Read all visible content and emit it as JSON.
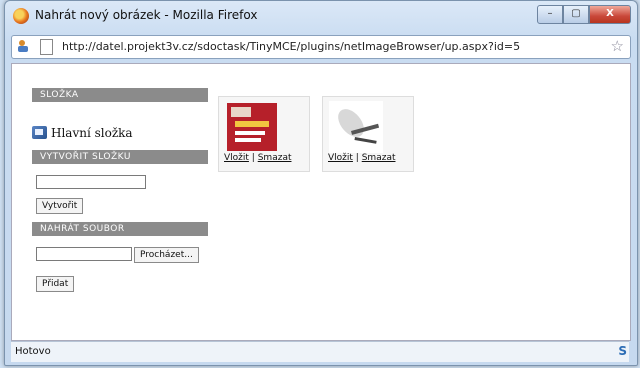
{
  "window": {
    "title": "Nahrát nový obrázek - Mozilla Firefox"
  },
  "titlebar": {
    "min": "–",
    "max": "▢",
    "close": "X"
  },
  "address": {
    "url": "http://datel.projekt3v.cz/sdoctask/TinyMCE/plugins/netImageBrowser/up.aspx?id=5"
  },
  "sidebar": {
    "folder_header": "SLOŽKA",
    "main_folder": "Hlavní složka",
    "create_header": "VYTVOŘIT SLOŽKU",
    "create_button": "Vytvořit",
    "upload_header": "NAHRÁT SOUBOR",
    "browse_button": "Procházet...",
    "add_button": "Přidat"
  },
  "images": [
    {
      "insert": "Vložit",
      "sep": "|",
      "delete": "Smazat"
    },
    {
      "insert": "Vložit",
      "sep": "|",
      "delete": "Smazat"
    }
  ],
  "status": {
    "text": "Hotovo",
    "icon": "S"
  }
}
